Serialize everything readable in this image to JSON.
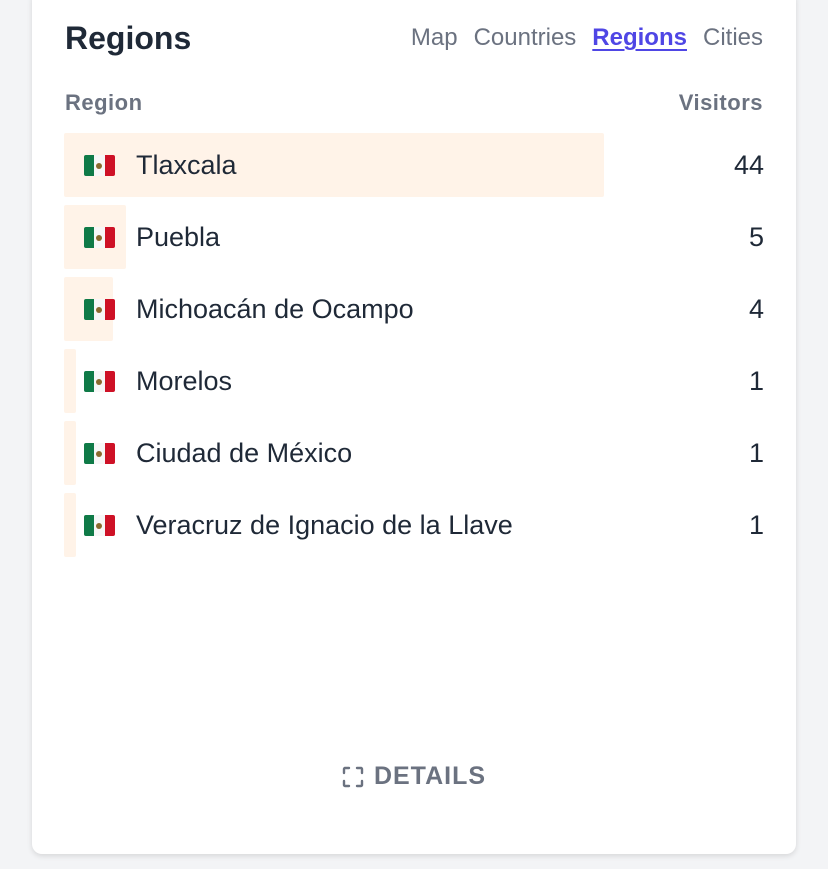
{
  "panel": {
    "title": "Regions",
    "tabs": [
      {
        "label": "Map",
        "active": false
      },
      {
        "label": "Countries",
        "active": false
      },
      {
        "label": "Regions",
        "active": true
      },
      {
        "label": "Cities",
        "active": false
      }
    ],
    "columns": {
      "left": "Region",
      "right": "Visitors"
    },
    "rows": [
      {
        "name": "Tlaxcala",
        "value": "44",
        "flag": "mexico-flag-icon",
        "share": 1.0
      },
      {
        "name": "Puebla",
        "value": "5",
        "flag": "mexico-flag-icon",
        "share": 0.114
      },
      {
        "name": "Michoacán de Ocampo",
        "value": "4",
        "flag": "mexico-flag-icon",
        "share": 0.091
      },
      {
        "name": "Morelos",
        "value": "1",
        "flag": "mexico-flag-icon",
        "share": 0.023
      },
      {
        "name": "Ciudad de México",
        "value": "1",
        "flag": "mexico-flag-icon",
        "share": 0.023
      },
      {
        "name": "Veracruz de Ignacio de la Llave",
        "value": "1",
        "flag": "mexico-flag-icon",
        "share": 0.023
      }
    ],
    "details": {
      "label": "DETAILS",
      "icon": "expand-icon"
    }
  },
  "colors": {
    "accent": "#4f46e5",
    "bar": "#fff3e8",
    "text": "#1f2937",
    "muted": "#6b7280"
  }
}
